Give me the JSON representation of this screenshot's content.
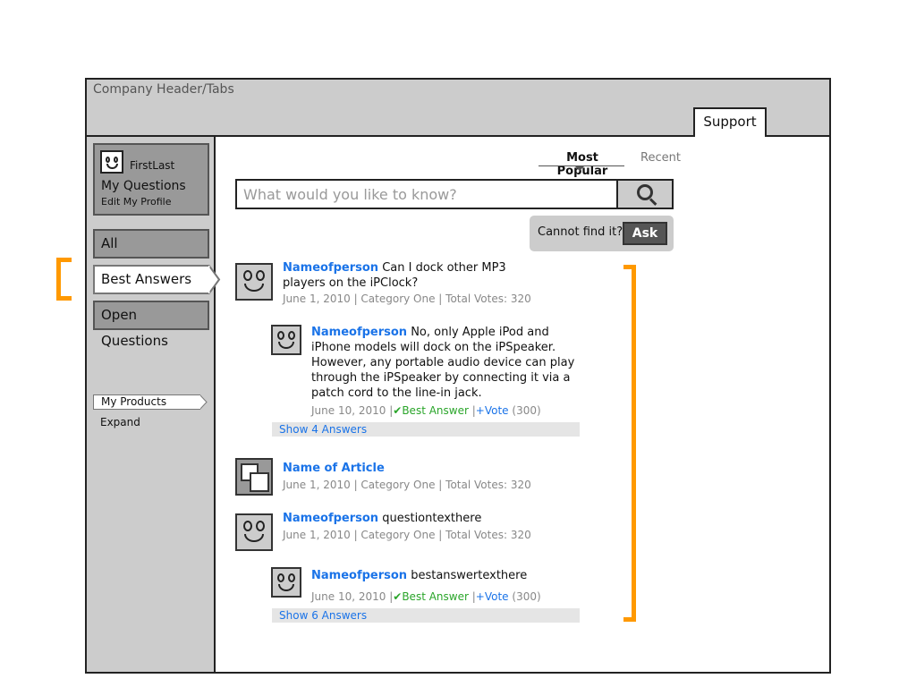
{
  "header": {
    "title": "Company Header/Tabs",
    "tab_support": "Support"
  },
  "profile": {
    "name": "FirstLast",
    "my_questions": "My Questions",
    "edit_profile": "Edit My Profile"
  },
  "sidebar": {
    "all": "All",
    "best_answers": "Best Answers",
    "open_questions": "Open Questions",
    "my_products": "My Products",
    "expand": "Expand"
  },
  "sort": {
    "most_popular": "Most Popular",
    "recent": "Recent"
  },
  "search": {
    "placeholder": "What would you like to know?"
  },
  "ask": {
    "prompt": "Cannot find it?",
    "button": "Ask"
  },
  "colors": {
    "accent_bracket": "#ff9900",
    "link_blue": "#1a73e8",
    "best_green": "#2aa52a"
  },
  "feed": {
    "q1": {
      "name": "Nameofperson",
      "text": "Can I dock other MP3 players on the iPClock?",
      "meta": "June 1, 2010 | Category One | Total Votes: 320",
      "answer": {
        "name": "Nameofperson",
        "text": "No, only Apple iPod and iPhone models will dock on the iPSpeaker. However, any portable audio device can play through the iPSpeaker by connecting it via a patch cord to the line-in jack.",
        "date": "June 10, 2010",
        "best_label": "Best Answer",
        "vote_label": "+Vote",
        "votes": "(300)"
      },
      "show_answers": "Show 4 Answers"
    },
    "article": {
      "title": "Name of Article",
      "meta": "June 1, 2010 | Category One | Total Votes: 320"
    },
    "q2": {
      "name": "Nameofperson",
      "text": "questiontexthere",
      "meta": "June 1, 2010 | Category One | Total Votes: 320",
      "answer": {
        "name": "Nameofperson",
        "text": "bestanswertexthere",
        "date": "June 10, 2010",
        "best_label": "Best Answer",
        "vote_label": "+Vote",
        "votes": "(300)"
      },
      "show_answers": "Show 6 Answers"
    }
  }
}
